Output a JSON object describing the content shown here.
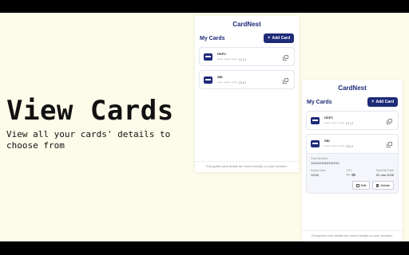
{
  "hero": {
    "title": "View Cards",
    "subtitle": "View all your cards' details to choose from"
  },
  "app": {
    "name": "CardNest",
    "section_title": "My Cards",
    "add_button": "Add Card",
    "footer": "Encrypted card details are stored locally on your browser.",
    "cards": [
      {
        "bank": "HDFC",
        "masked": "**** **** **** 1212"
      },
      {
        "bank": "SBI",
        "masked": "**** **** **** 2312"
      }
    ],
    "expanded": {
      "bank": "SBI",
      "masked": "**** **** **** 2312",
      "card_number_label": "Card Number",
      "card_number": "1212121212121212",
      "expiry_label": "Expiry Date",
      "expiry": "12/34",
      "cvv_label": "CVV",
      "cvv": "***",
      "bill_label": "Next Bill Date",
      "bill": "02 Jan 2026",
      "edit": "Edit",
      "delete": "Delete"
    }
  },
  "colors": {
    "accent": "#1e2a78",
    "background": "#fdfbe9"
  },
  "icons": [
    "plus-icon",
    "bank-card-icon",
    "copy-icon",
    "eye-icon",
    "edit-icon",
    "trash-icon"
  ]
}
